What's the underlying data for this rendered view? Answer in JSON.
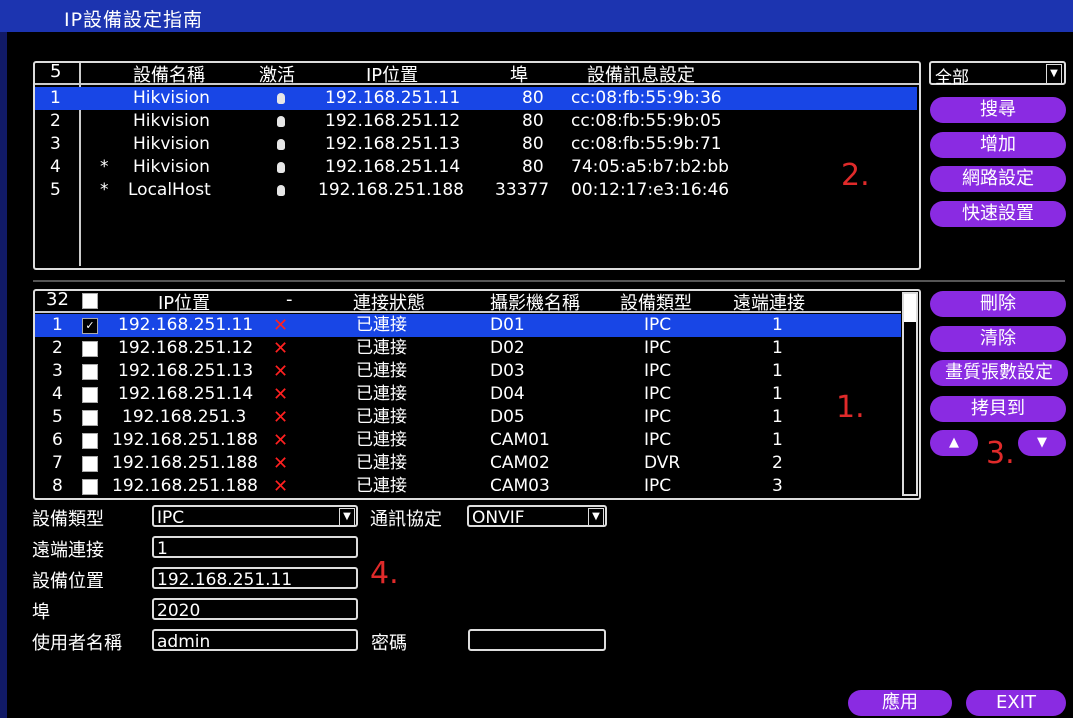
{
  "window": {
    "title": "IP設備設定指南"
  },
  "discovered": {
    "header": {
      "count": "5",
      "name": "設備名稱",
      "active": "激活",
      "ip": "IP位置",
      "port": "埠",
      "info": "設備訊息設定"
    },
    "rows": [
      {
        "idx": "1",
        "flag": "",
        "name": "Hikvision",
        "ip": "192.168.251.11",
        "port": "80",
        "mac": "cc:08:fb:55:9b:36"
      },
      {
        "idx": "2",
        "flag": "",
        "name": "Hikvision",
        "ip": "192.168.251.12",
        "port": "80",
        "mac": "cc:08:fb:55:9b:05"
      },
      {
        "idx": "3",
        "flag": "",
        "name": "Hikvision",
        "ip": "192.168.251.13",
        "port": "80",
        "mac": "cc:08:fb:55:9b:71"
      },
      {
        "idx": "4",
        "flag": "*",
        "name": "Hikvision",
        "ip": "192.168.251.14",
        "port": "80",
        "mac": "74:05:a5:b7:b2:bb"
      },
      {
        "idx": "5",
        "flag": "*",
        "name": "LocalHost",
        "ip": "192.168.251.188",
        "port": "33377",
        "mac": "00:12:17:e3:16:46"
      }
    ]
  },
  "filter": {
    "selected": "全部"
  },
  "top_buttons": {
    "search": "搜尋",
    "add": "增加",
    "network": "網路設定",
    "quick": "快速設置"
  },
  "added": {
    "header": {
      "count": "32",
      "ip": "IP位置",
      "dash": "-",
      "status": "連接狀態",
      "cam": "攝影機名稱",
      "type": "設備類型",
      "remote": "遠端連接"
    },
    "rows": [
      {
        "idx": "1",
        "ip": "192.168.251.11",
        "status": "已連接",
        "cam": "D01",
        "type": "IPC",
        "remote": "1"
      },
      {
        "idx": "2",
        "ip": "192.168.251.12",
        "status": "已連接",
        "cam": "D02",
        "type": "IPC",
        "remote": "1"
      },
      {
        "idx": "3",
        "ip": "192.168.251.13",
        "status": "已連接",
        "cam": "D03",
        "type": "IPC",
        "remote": "1"
      },
      {
        "idx": "4",
        "ip": "192.168.251.14",
        "status": "已連接",
        "cam": "D04",
        "type": "IPC",
        "remote": "1"
      },
      {
        "idx": "5",
        "ip": "192.168.251.3",
        "status": "已連接",
        "cam": "D05",
        "type": "IPC",
        "remote": "1"
      },
      {
        "idx": "6",
        "ip": "192.168.251.188",
        "status": "已連接",
        "cam": "CAM01",
        "type": "IPC",
        "remote": "1"
      },
      {
        "idx": "7",
        "ip": "192.168.251.188",
        "status": "已連接",
        "cam": "CAM02",
        "type": "DVR",
        "remote": "2"
      },
      {
        "idx": "8",
        "ip": "192.168.251.188",
        "status": "已連接",
        "cam": "CAM03",
        "type": "IPC",
        "remote": "3"
      }
    ]
  },
  "side_buttons": {
    "delete": "刪除",
    "clear": "清除",
    "quality": "畫質張數設定",
    "copy": "拷貝到",
    "up": "▲",
    "down": "▼"
  },
  "form": {
    "type_label": "設備類型",
    "type_value": "IPC",
    "protocol_label": "通訊協定",
    "protocol_value": "ONVIF",
    "remote_label": "遠端連接",
    "remote_value": "1",
    "ip_label": "設備位置",
    "ip_value": "192.168.251.11",
    "port_label": "埠",
    "port_value": "2020",
    "user_label": "使用者名稱",
    "user_value": "admin",
    "pass_label": "密碼",
    "pass_value": ""
  },
  "annotations": {
    "a1": "1.",
    "a2": "2.",
    "a3": "3.",
    "a4": "4."
  },
  "footer": {
    "apply": "應用",
    "exit": "EXIT"
  },
  "colors": {
    "title": "#1c34b0",
    "selected": "#1846e6",
    "button": "#8a2be2",
    "annotation": "#e02a2a",
    "x": "#ff2020"
  }
}
